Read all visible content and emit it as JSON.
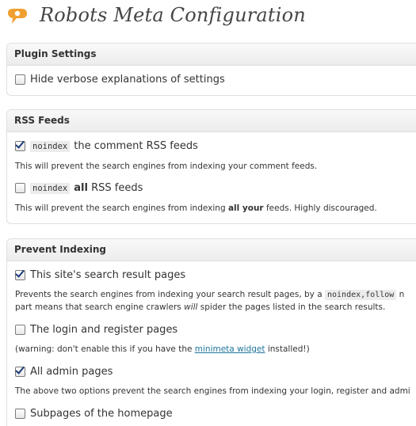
{
  "header": {
    "title": "Robots Meta Configuration",
    "logo_icon": "yoast-logo-icon"
  },
  "plugin_settings": {
    "title": "Plugin Settings",
    "hide_verbose": {
      "label": "Hide verbose explanations of settings",
      "checked": false
    }
  },
  "rss_feeds": {
    "title": "RSS Feeds",
    "comment_feeds": {
      "code": "noindex",
      "label": "the comment RSS feeds",
      "checked": true,
      "description": "This will prevent the search engines from indexing your comment feeds."
    },
    "all_feeds": {
      "code": "noindex",
      "label_bold": "all",
      "label": "RSS feeds",
      "checked": false,
      "description_pre": "This will prevent the search engines from indexing ",
      "description_bold": "all your",
      "description_post": " feeds. Highly discouraged."
    }
  },
  "prevent_indexing": {
    "title": "Prevent Indexing",
    "search_results": {
      "label": "This site's search result pages",
      "checked": true,
      "description_line1_pre": "Prevents the search engines from indexing your search result pages, by a ",
      "description_line1_code": "noindex,follow",
      "description_line1_post": " n",
      "description_line2_pre": "part means that search engine crawlers ",
      "description_line2_em": "will",
      "description_line2_post": " spider the pages listed in the search results."
    },
    "login_register": {
      "label": "The login and register pages",
      "checked": false,
      "description_pre": "(warning: don't enable this if you have the ",
      "description_link": "minimeta widget",
      "description_post": " installed!)"
    },
    "admin_pages": {
      "label": "All admin pages",
      "checked": true,
      "description": "The above two options prevent the search engines from indexing your login, register and admi"
    },
    "subpages_home": {
      "label": "Subpages of the homepage",
      "checked": false
    }
  }
}
